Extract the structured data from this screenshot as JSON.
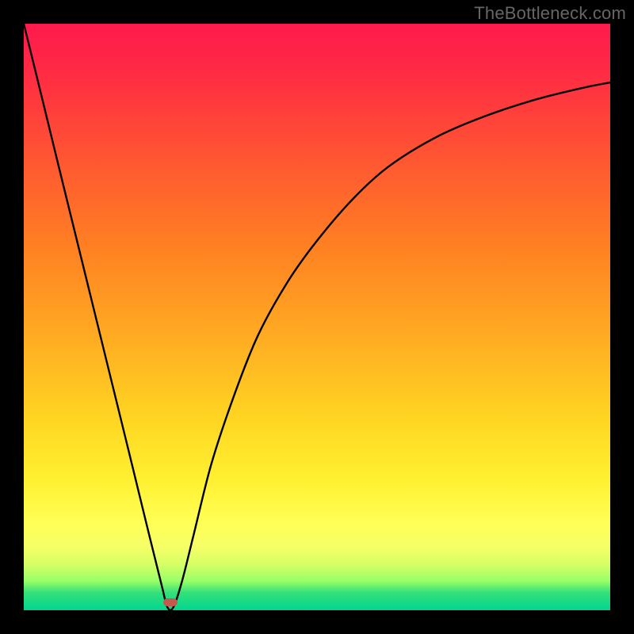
{
  "watermark": "TheBottleneck.com",
  "chart_data": {
    "type": "line",
    "title": "",
    "xlabel": "",
    "ylabel": "",
    "xlim": [
      0,
      100
    ],
    "ylim": [
      0,
      100
    ],
    "grid": false,
    "legend": false,
    "annotations": [],
    "series": [
      {
        "name": "bottleneck-curve",
        "color": "#000000",
        "x": [
          0,
          3,
          6,
          9,
          12,
          15,
          18,
          21,
          23.5,
          24.5,
          25.5,
          27,
          29,
          32,
          36,
          40,
          45,
          50,
          56,
          62,
          70,
          78,
          87,
          95,
          100
        ],
        "y": [
          100,
          87.8,
          75.5,
          63.3,
          51.1,
          38.9,
          26.7,
          14.4,
          4.3,
          0.5,
          0.5,
          5,
          13,
          25,
          37,
          47,
          56,
          63,
          70,
          75.5,
          80.5,
          84,
          87,
          89,
          90
        ]
      }
    ],
    "marker": {
      "x": 25,
      "y": 1.3,
      "color": "#c45a4f"
    }
  }
}
